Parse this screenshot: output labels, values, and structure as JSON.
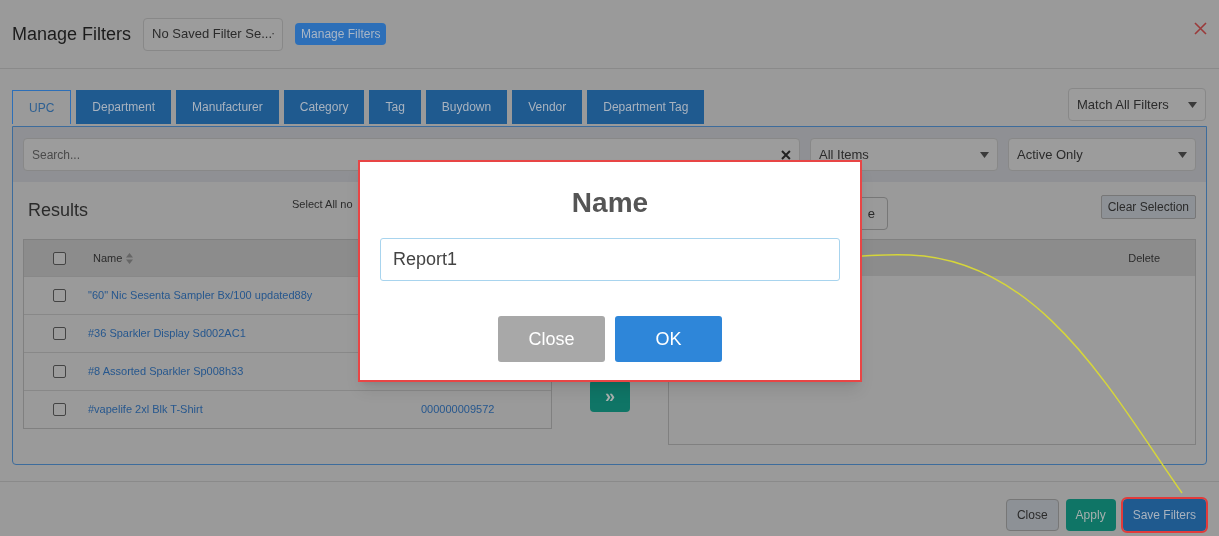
{
  "header": {
    "title": "Manage Filters",
    "saved_filter_select": "No Saved Filter Se...",
    "manage_button": "Manage Filters"
  },
  "tabs": [
    {
      "label": "UPC",
      "selected": true
    },
    {
      "label": "Department",
      "selected": false
    },
    {
      "label": "Manufacturer",
      "selected": false
    },
    {
      "label": "Category",
      "selected": false
    },
    {
      "label": "Tag",
      "selected": false
    },
    {
      "label": "Buydown",
      "selected": false
    },
    {
      "label": "Vendor",
      "selected": false
    },
    {
      "label": "Department Tag",
      "selected": false
    }
  ],
  "match_select": "Match All Filters",
  "search": {
    "placeholder": "Search..."
  },
  "items_select": "All Items",
  "status_select": "Active Only",
  "results": {
    "title": "Results",
    "select_all": "Select All no",
    "header_checked": false,
    "name_column": "Name",
    "rows": [
      {
        "name": "\"60\" Nic Sesenta Sampler Bx/100 updated88y",
        "checked": false
      },
      {
        "name": "#36 Sparkler Display Sd002AC1",
        "checked": false
      },
      {
        "name": "#8 Assorted Sparkler Sp008h33",
        "checked": false
      },
      {
        "name": "#vapelife 2xl Blk T-Shirt",
        "code": "000000009572",
        "checked": false
      }
    ]
  },
  "move_button": "»",
  "selected_panel": {
    "partial_button": "e",
    "clear_button": "Clear Selection",
    "delete_column": "Delete"
  },
  "footer": {
    "buttons": [
      {
        "label": "Close",
        "kind": "close"
      },
      {
        "label": "Apply",
        "kind": "apply"
      },
      {
        "label": "Save Filters",
        "kind": "save",
        "highlighted": true
      }
    ]
  },
  "dialog": {
    "title": "Name",
    "value": "Report1",
    "buttons": [
      {
        "label": "Close",
        "kind": "close"
      },
      {
        "label": "OK",
        "kind": "ok"
      }
    ]
  }
}
